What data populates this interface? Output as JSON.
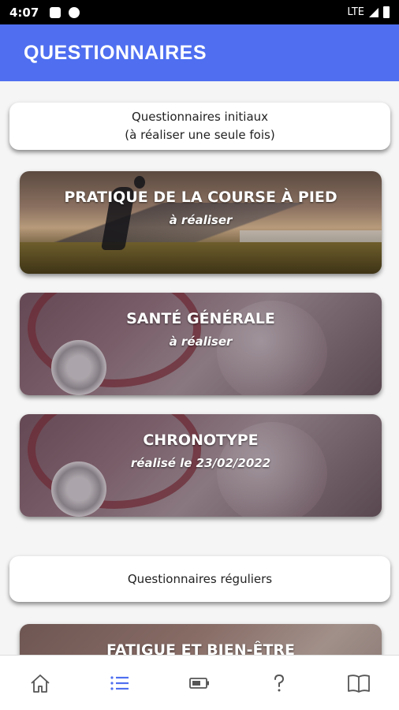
{
  "status_bar": {
    "time": "4:07",
    "network": "LTE"
  },
  "app_bar": {
    "title": "QUESTIONNAIRES"
  },
  "sections": {
    "initial": {
      "line1": "Questionnaires initiaux",
      "line2": "(à réaliser une seule fois)"
    },
    "regular": {
      "line1": "Questionnaires réguliers"
    }
  },
  "cards": [
    {
      "title": "PRATIQUE DE LA COURSE À PIED",
      "status": "à réaliser"
    },
    {
      "title": "SANTÉ GÉNÉRALE",
      "status": "à réaliser"
    },
    {
      "title": "CHRONOTYPE",
      "status": "réalisé le 23/02/2022"
    },
    {
      "title": "FATIGUE ET BIEN-ÊTRE"
    }
  ],
  "bottom_nav": [
    {
      "icon": "home-icon"
    },
    {
      "icon": "list-icon",
      "active": true
    },
    {
      "icon": "battery-icon"
    },
    {
      "icon": "help-icon"
    },
    {
      "icon": "book-icon"
    }
  ],
  "colors": {
    "primary": "#4f6ff0",
    "nav_active": "#4f6ff0",
    "nav_inactive": "#555555"
  }
}
